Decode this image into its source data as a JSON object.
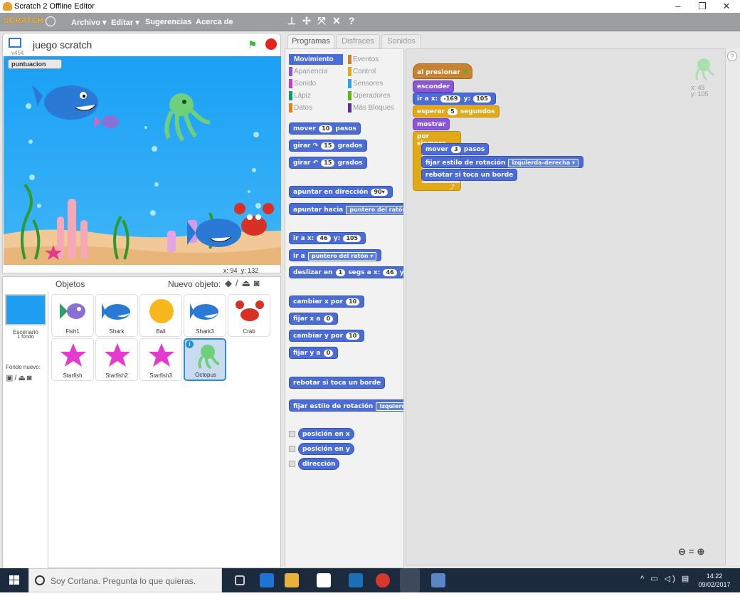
{
  "window": {
    "title": "Scratch 2 Offline Editor"
  },
  "menu": {
    "logo": "SCRATCH",
    "items": [
      "Archivo ▾",
      "Editar ▾",
      "Sugerencias",
      "Acerca de"
    ]
  },
  "stage": {
    "project_name": "juego scratch",
    "version": "v454",
    "variable_label": "puntuacion",
    "variable_value": "",
    "mouse_x_label": "x:",
    "mouse_x": "94",
    "mouse_y_label": "y:",
    "mouse_y": "132"
  },
  "sprites_pane": {
    "header": "Objetos",
    "new_sprite_label": "Nuevo objeto:",
    "stage_name": "Escenario",
    "stage_backdrops": "1 fondo",
    "new_backdrop_label": "Fondo nuevo:",
    "sprites": [
      {
        "name": "Fish1"
      },
      {
        "name": "Shark"
      },
      {
        "name": "Ball"
      },
      {
        "name": "Shark3"
      },
      {
        "name": "Crab"
      },
      {
        "name": "Starfish"
      },
      {
        "name": "Starfish2"
      },
      {
        "name": "Starfish3"
      },
      {
        "name": "Octopus",
        "selected": true
      }
    ]
  },
  "tabs": [
    "Programas",
    "Disfraces",
    "Sonidos"
  ],
  "categories": {
    "left": [
      {
        "label": "Movimiento",
        "color": "#4a6cd4",
        "active": true
      },
      {
        "label": "Apariencia",
        "color": "#8a55d7"
      },
      {
        "label": "Sonido",
        "color": "#bb42c3"
      },
      {
        "label": "Lápiz",
        "color": "#0e9a6c"
      },
      {
        "label": "Datos",
        "color": "#ee7d16"
      }
    ],
    "right": [
      {
        "label": "Eventos",
        "color": "#c88330"
      },
      {
        "label": "Control",
        "color": "#e1a91a"
      },
      {
        "label": "Sensores",
        "color": "#2ca5e2"
      },
      {
        "label": "Operadores",
        "color": "#5cb712"
      },
      {
        "label": "Más Bloques",
        "color": "#632d99"
      }
    ]
  },
  "palette": {
    "mover": "mover",
    "mover_n": "10",
    "mover_pasos": "pasos",
    "girar": "girar",
    "girar_n1": "15",
    "grados": "grados",
    "girar_n2": "15",
    "apuntar_dir": "apuntar en dirección",
    "apuntar_dir_n": "90▾",
    "apuntar_hacia": "apuntar hacia",
    "apuntar_hacia_opt": "puntero del ratón ▾",
    "ir_a_x": "ir a x:",
    "ir_x": "46",
    "y": "y:",
    "ir_y": "105",
    "ir_a": "ir a",
    "ir_a_opt": "puntero del ratón ▾",
    "deslizar": "deslizar en",
    "deslizar_n": "1",
    "segs_a_x": "segs a x:",
    "deslizar_x": "46",
    "cambiar_x": "cambiar x por",
    "cambiar_x_n": "10",
    "fijar_x": "fijar x a",
    "fijar_x_n": "0",
    "cambiar_y": "cambiar y por",
    "cambiar_y_n": "10",
    "fijar_y": "fijar y a",
    "fijar_y_n": "0",
    "rebotar": "rebotar si toca un borde",
    "fijar_estilo": "fijar estilo de rotación",
    "fijar_estilo_opt": "izquierda-d",
    "pos_x": "posición en x",
    "pos_y": "posición en y",
    "direccion": "dirección"
  },
  "script": {
    "al_presionar": "al presionar",
    "esconder": "esconder",
    "ir_a_x": "ir a x:",
    "x": "-169",
    "y_label": "y:",
    "y": "105",
    "esperar": "esperar",
    "esperar_n": "5",
    "segundos": "segundos",
    "mostrar": "mostrar",
    "por_siempre": "por siempre",
    "mover": "mover",
    "mover_n": "3",
    "pasos": "pasos",
    "fijar_estilo": "fijar estilo de rotación",
    "fijar_estilo_opt": "izquierda-derecha ▾",
    "rebotar": "rebotar si toca un borde"
  },
  "sprite_info": {
    "x_label": "x:",
    "x": "45",
    "y_label": "y:",
    "y": "105"
  },
  "taskbar": {
    "cortana_text": "Soy Cortana. Pregunta lo que quieras.",
    "time": "14:22",
    "date": "09/02/2017"
  }
}
